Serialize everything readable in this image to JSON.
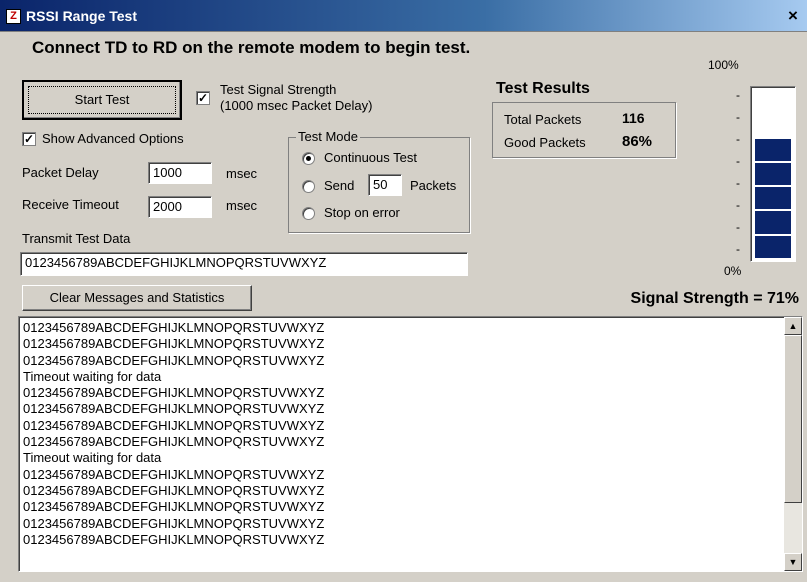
{
  "window": {
    "title": "RSSI Range Test",
    "icon_text": "Z",
    "close_glyph": "×"
  },
  "instruction": "Connect TD to RD on the remote modem to begin test.",
  "start_button": "Start Test",
  "test_signal": {
    "label_line1": "Test Signal Strength",
    "label_line2": "(1000 msec Packet Delay)",
    "checked": true
  },
  "advanced": {
    "label": "Show Advanced Options",
    "checked": true
  },
  "packet_delay": {
    "label": "Packet Delay",
    "value": "1000",
    "unit": "msec"
  },
  "receive_timeout": {
    "label": "Receive Timeout",
    "value": "2000",
    "unit": "msec"
  },
  "test_mode": {
    "title": "Test Mode",
    "continuous": "Continuous Test",
    "send": "Send",
    "send_count": "50",
    "packets": "Packets",
    "stop": "Stop on error",
    "selected": "continuous"
  },
  "transmit": {
    "label": "Transmit Test Data",
    "value": "0123456789ABCDEFGHIJKLMNOPQRSTUVWXYZ"
  },
  "results": {
    "title": "Test Results",
    "total_label": "Total Packets",
    "total_value": "116",
    "good_label": "Good Packets",
    "good_value": "86%"
  },
  "meter": {
    "top_label": "100%",
    "bottom_label": "0%",
    "tick": "-",
    "segments_lit": 5,
    "segments_total": 7,
    "color": "#0a246a"
  },
  "clear_button": "Clear Messages and Statistics",
  "signal_strength": "Signal Strength = 71%",
  "messages": [
    "0123456789ABCDEFGHIJKLMNOPQRSTUVWXYZ",
    "0123456789ABCDEFGHIJKLMNOPQRSTUVWXYZ",
    "0123456789ABCDEFGHIJKLMNOPQRSTUVWXYZ",
    "Timeout waiting for data",
    "0123456789ABCDEFGHIJKLMNOPQRSTUVWXYZ",
    "0123456789ABCDEFGHIJKLMNOPQRSTUVWXYZ",
    "0123456789ABCDEFGHIJKLMNOPQRSTUVWXYZ",
    "0123456789ABCDEFGHIJKLMNOPQRSTUVWXYZ",
    "Timeout waiting for data",
    "0123456789ABCDEFGHIJKLMNOPQRSTUVWXYZ",
    "0123456789ABCDEFGHIJKLMNOPQRSTUVWXYZ",
    "0123456789ABCDEFGHIJKLMNOPQRSTUVWXYZ",
    "0123456789ABCDEFGHIJKLMNOPQRSTUVWXYZ",
    "0123456789ABCDEFGHIJKLMNOPQRSTUVWXYZ"
  ],
  "scrollbar": {
    "up_glyph": "▲",
    "down_glyph": "▼"
  }
}
